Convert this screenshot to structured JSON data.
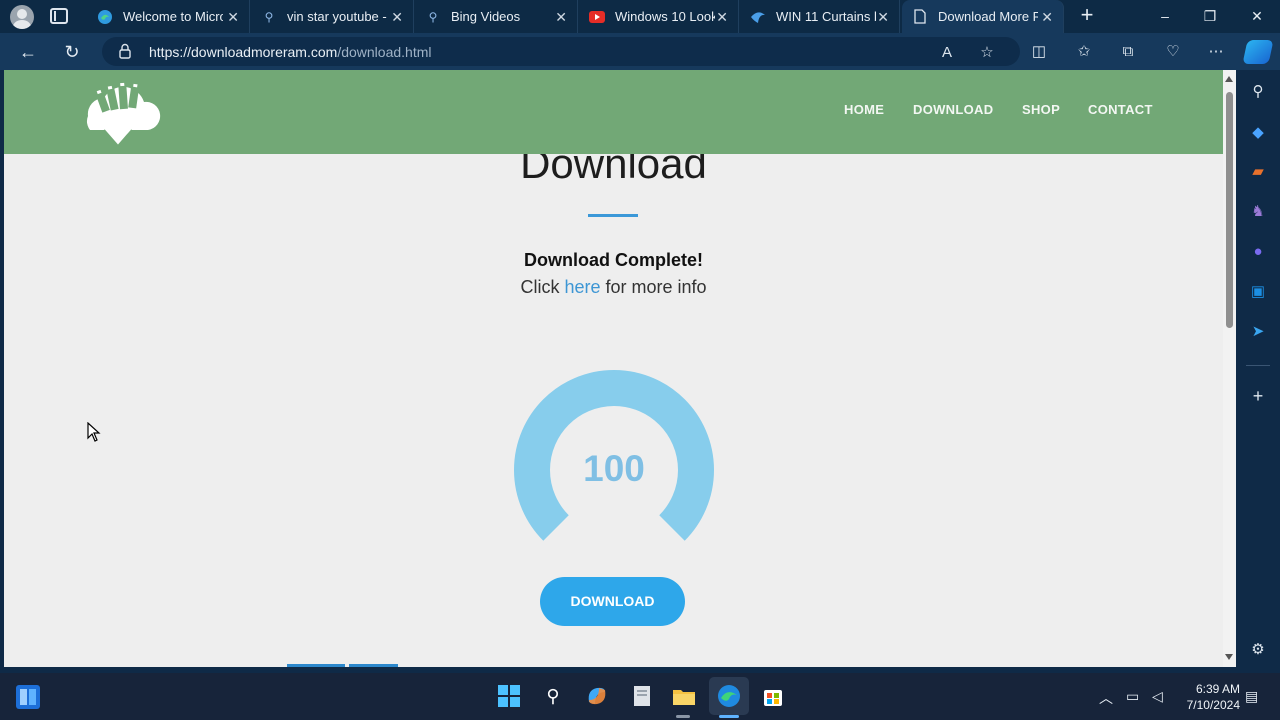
{
  "tabs": [
    {
      "label": "Welcome to Micro",
      "icon": "edge-icon",
      "active": false
    },
    {
      "label": "vin star youtube -",
      "icon": "search-icon",
      "active": false
    },
    {
      "label": "Bing Videos",
      "icon": "search-icon",
      "active": false
    },
    {
      "label": "Windows 10 Look",
      "icon": "youtube-icon",
      "active": false
    },
    {
      "label": "WIN 11 Curtains b",
      "icon": "curtains-app-icon",
      "active": false
    },
    {
      "label": "Download More R",
      "icon": "page-icon",
      "active": true
    }
  ],
  "address": {
    "url_host": "https://downloadmoreram.com",
    "url_path": "/download.html"
  },
  "site": {
    "nav": [
      "HOME",
      "DOWNLOAD",
      "SHOP",
      "CONTACT"
    ],
    "title": "Download",
    "status": "Download Complete!",
    "info_prefix": "Click ",
    "info_link": "here",
    "info_suffix": " for more info",
    "progress_value": "100",
    "download_button": "DOWNLOAD",
    "colors": {
      "header": "#72a876",
      "accent": "#2ea7ea",
      "gauge": "#87cdec"
    }
  },
  "gauge": {
    "value": 100,
    "max": 100
  },
  "taskbar": {
    "time": "6:39 AM",
    "date": "7/10/2024"
  }
}
